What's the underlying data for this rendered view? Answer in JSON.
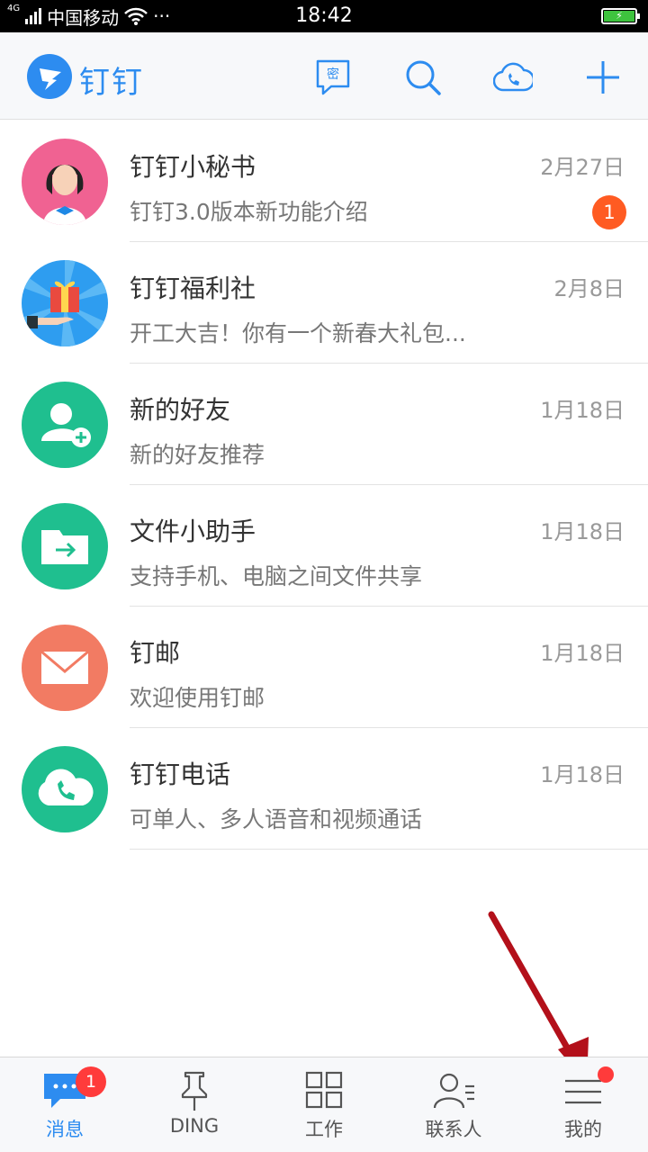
{
  "status_bar": {
    "network": "4G",
    "carrier": "中国移动",
    "more": "···",
    "time": "18:42"
  },
  "header": {
    "brand": "钉钉",
    "secret_icon_text": "密"
  },
  "conversations": [
    {
      "title": "钉钉小秘书",
      "subtitle": "钉钉3.0版本新功能介绍",
      "date": "2月27日",
      "unread": "1",
      "avatar": "assistant-avatar"
    },
    {
      "title": "钉钉福利社",
      "subtitle": "开工大吉！你有一个新春大礼包...",
      "date": "2月8日",
      "unread": "",
      "avatar": "gift-avatar"
    },
    {
      "title": "新的好友",
      "subtitle": "新的好友推荐",
      "date": "1月18日",
      "unread": "",
      "avatar": "add-friend-avatar"
    },
    {
      "title": "文件小助手",
      "subtitle": "支持手机、电脑之间文件共享",
      "date": "1月18日",
      "unread": "",
      "avatar": "file-avatar"
    },
    {
      "title": "钉邮",
      "subtitle": "欢迎使用钉邮",
      "date": "1月18日",
      "unread": "",
      "avatar": "mail-avatar"
    },
    {
      "title": "钉钉电话",
      "subtitle": "可单人、多人语音和视频通话",
      "date": "1月18日",
      "unread": "",
      "avatar": "phone-avatar"
    }
  ],
  "tabs": [
    {
      "label": "消息",
      "badge": "1",
      "active": true,
      "icon": "chat-icon"
    },
    {
      "label": "DING",
      "badge": "",
      "active": false,
      "icon": "pin-icon"
    },
    {
      "label": "工作",
      "badge": "",
      "active": false,
      "icon": "grid-icon"
    },
    {
      "label": "联系人",
      "badge": "",
      "active": false,
      "icon": "contacts-icon"
    },
    {
      "label": "我的",
      "badge": "dot",
      "active": false,
      "icon": "menu-icon"
    }
  ],
  "colors": {
    "brand": "#2d8cf0",
    "green": "#1fbf8f",
    "badge": "#ff5b22",
    "mail": "#f27b63",
    "pink": "#f06292"
  }
}
